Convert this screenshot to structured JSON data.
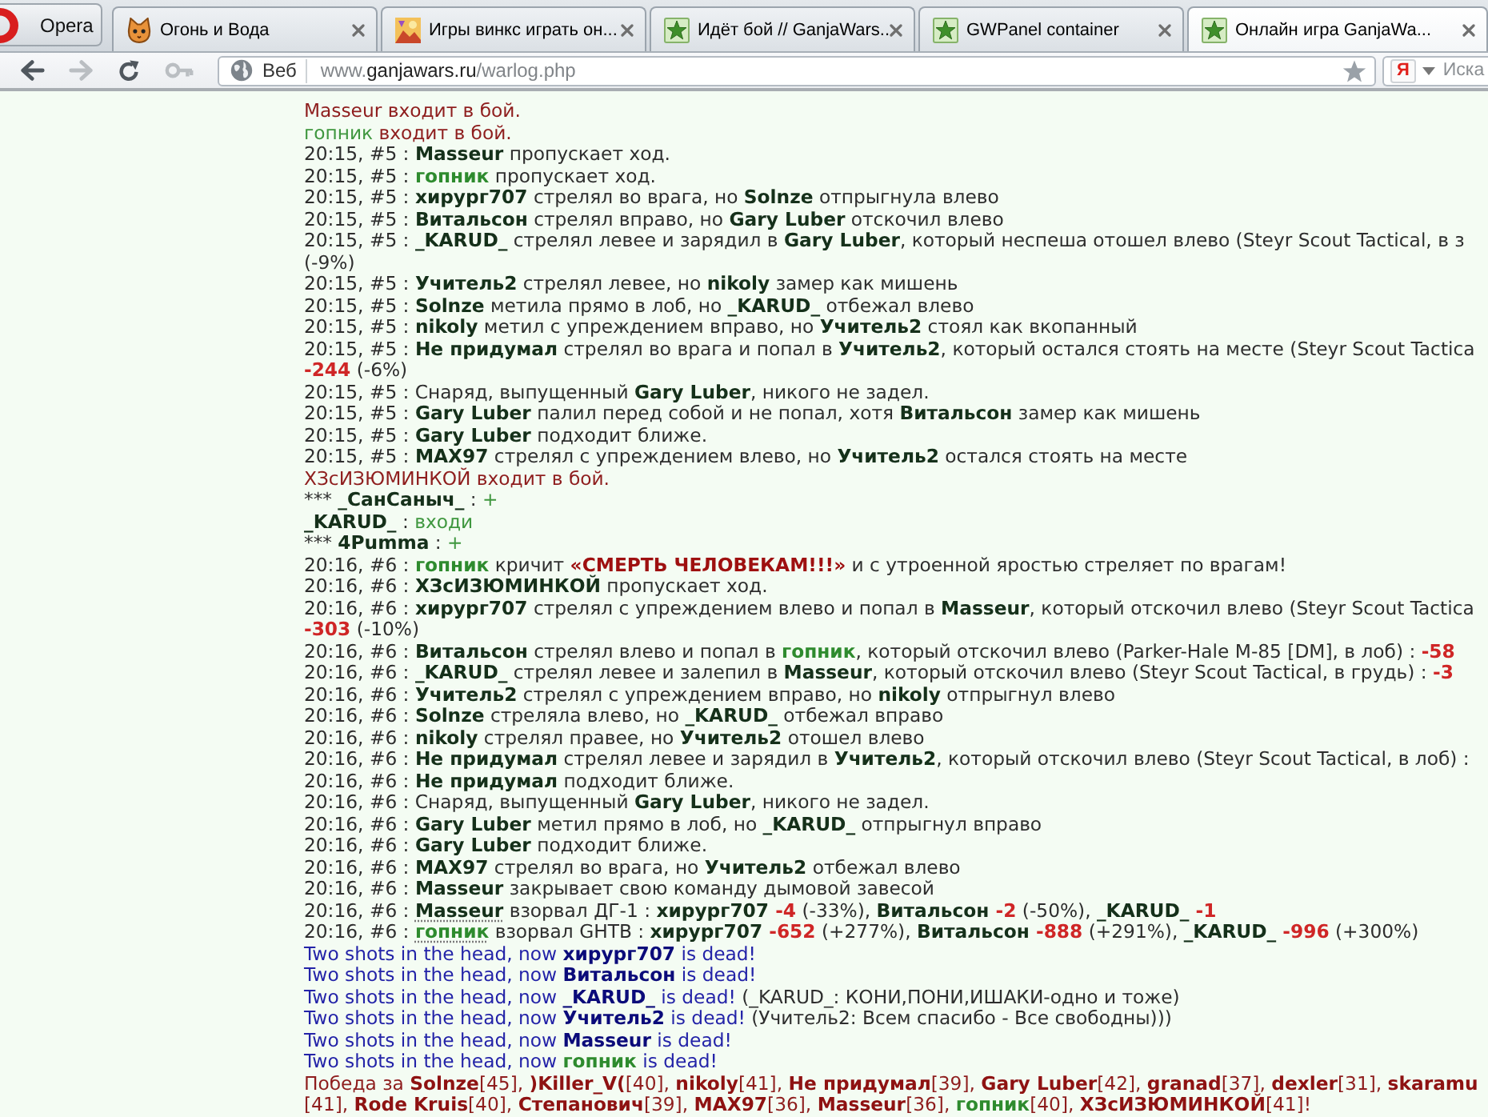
{
  "browser": {
    "menu_button": "Opera",
    "tabs": [
      {
        "kind": "cat",
        "title": "Огонь и Вода",
        "selected": false
      },
      {
        "kind": "picture",
        "title": "Игры винкс играть он...",
        "selected": false
      },
      {
        "kind": "star",
        "title": "Идёт бой // GanjaWars...",
        "selected": false
      },
      {
        "kind": "star",
        "title": "GWPanel container",
        "selected": false
      },
      {
        "kind": "star",
        "title": "Онлайн игра GanjaWa...",
        "selected": true
      }
    ]
  },
  "toolbar": {
    "buttons": [
      {
        "kind": "back",
        "disabled": false
      },
      {
        "kind": "forward",
        "disabled": true
      },
      {
        "kind": "reload",
        "disabled": false
      },
      {
        "kind": "key",
        "disabled": true
      }
    ],
    "address": {
      "site_button": "Веб",
      "url": {
        "prefix": "www.",
        "domain": "ganjawars.ru",
        "path": "/warlog.php"
      }
    },
    "search": {
      "engine": "Я",
      "placeholder": "Иска"
    }
  },
  "log": [
    {
      "parts": [
        {
          "kind": "event",
          "text": "Masseur входит в бой."
        }
      ]
    },
    {
      "parts": [
        {
          "kind": "ally-text",
          "text": "гопник"
        },
        {
          "kind": "event",
          "text": " входит в бой."
        }
      ]
    },
    {
      "parts": [
        {
          "kind": "text",
          "text": "20:15, #5 : "
        },
        {
          "kind": "name",
          "text": "Masseur"
        },
        {
          "kind": "text",
          "text": " пропускает ход."
        }
      ]
    },
    {
      "parts": [
        {
          "kind": "text",
          "text": "20:15, #5 : "
        },
        {
          "kind": "ally",
          "text": "гопник"
        },
        {
          "kind": "text",
          "text": " пропускает ход."
        }
      ]
    },
    {
      "parts": [
        {
          "kind": "text",
          "text": "20:15, #5 : "
        },
        {
          "kind": "name",
          "text": "хирург707"
        },
        {
          "kind": "text",
          "text": " стрелял во врага, но "
        },
        {
          "kind": "name",
          "text": "Solnze"
        },
        {
          "kind": "text",
          "text": " отпрыгнула влево"
        }
      ]
    },
    {
      "parts": [
        {
          "kind": "text",
          "text": "20:15, #5 : "
        },
        {
          "kind": "name",
          "text": "Витальсон"
        },
        {
          "kind": "text",
          "text": " стрелял вправо, но "
        },
        {
          "kind": "name",
          "text": "Gary Luber"
        },
        {
          "kind": "text",
          "text": " отскочил влево"
        }
      ]
    },
    {
      "parts": [
        {
          "kind": "text",
          "text": "20:15, #5 : "
        },
        {
          "kind": "name",
          "text": "_KARUD_"
        },
        {
          "kind": "text",
          "text": " стрелял левее и зарядил в "
        },
        {
          "kind": "name",
          "text": "Gary Luber"
        },
        {
          "kind": "text",
          "text": ", который неспеша отошел влево (Steyr Scout Tactical, в з"
        }
      ]
    },
    {
      "parts": [
        {
          "kind": "text",
          "text": "(-9%)"
        }
      ]
    },
    {
      "parts": [
        {
          "kind": "text",
          "text": "20:15, #5 : "
        },
        {
          "kind": "name",
          "text": "Учитель2"
        },
        {
          "kind": "text",
          "text": " стрелял левее, но "
        },
        {
          "kind": "name",
          "text": "nikoly"
        },
        {
          "kind": "text",
          "text": " замер как мишень"
        }
      ]
    },
    {
      "parts": [
        {
          "kind": "text",
          "text": "20:15, #5 : "
        },
        {
          "kind": "name",
          "text": "Solnze"
        },
        {
          "kind": "text",
          "text": " метила прямо в лоб, но "
        },
        {
          "kind": "name",
          "text": "_KARUD_"
        },
        {
          "kind": "text",
          "text": " отбежал влево"
        }
      ]
    },
    {
      "parts": [
        {
          "kind": "text",
          "text": "20:15, #5 : "
        },
        {
          "kind": "name",
          "text": "nikoly"
        },
        {
          "kind": "text",
          "text": " метил с упреждением вправо, но "
        },
        {
          "kind": "name",
          "text": "Учитель2"
        },
        {
          "kind": "text",
          "text": " стоял как вкопанный"
        }
      ]
    },
    {
      "parts": [
        {
          "kind": "text",
          "text": "20:15, #5 : "
        },
        {
          "kind": "name",
          "text": "Не придумал"
        },
        {
          "kind": "text",
          "text": " стрелял во врага и попал в "
        },
        {
          "kind": "name",
          "text": "Учитель2"
        },
        {
          "kind": "text",
          "text": ", который остался стоять на месте (Steyr Scout Tactica"
        }
      ]
    },
    {
      "parts": [
        {
          "kind": "damage",
          "text": "-244"
        },
        {
          "kind": "text",
          "text": " (-6%)"
        }
      ]
    },
    {
      "parts": [
        {
          "kind": "text",
          "text": "20:15, #5 : Снаряд, выпущенный "
        },
        {
          "kind": "name",
          "text": "Gary Luber"
        },
        {
          "kind": "text",
          "text": ", никого не задел."
        }
      ]
    },
    {
      "parts": [
        {
          "kind": "text",
          "text": "20:15, #5 : "
        },
        {
          "kind": "name",
          "text": "Gary Luber"
        },
        {
          "kind": "text",
          "text": " палил перед собой и не попал, хотя "
        },
        {
          "kind": "name",
          "text": "Витальсон"
        },
        {
          "kind": "text",
          "text": " замер как мишень"
        }
      ]
    },
    {
      "parts": [
        {
          "kind": "text",
          "text": "20:15, #5 : "
        },
        {
          "kind": "name",
          "text": "Gary Luber"
        },
        {
          "kind": "text",
          "text": " подходит ближе."
        }
      ]
    },
    {
      "parts": [
        {
          "kind": "text",
          "text": "20:15, #5 : "
        },
        {
          "kind": "name",
          "text": "MAX97"
        },
        {
          "kind": "text",
          "text": " стрелял с упреждением влево, но "
        },
        {
          "kind": "name",
          "text": "Учитель2"
        },
        {
          "kind": "text",
          "text": " остался стоять на месте"
        }
      ]
    },
    {
      "parts": [
        {
          "kind": "event",
          "text": "ХЗсИЗЮМИНКОЙ входит в бой."
        }
      ]
    },
    {
      "parts": [
        {
          "kind": "text",
          "text": "*** "
        },
        {
          "kind": "name",
          "text": "_СанСаныч_"
        },
        {
          "kind": "text",
          "text": " : "
        },
        {
          "kind": "ally-text",
          "text": "+"
        }
      ]
    },
    {
      "parts": [
        {
          "kind": "name",
          "text": "_KARUD_"
        },
        {
          "kind": "text",
          "text": " : "
        },
        {
          "kind": "ally-text",
          "text": "входи"
        }
      ]
    },
    {
      "parts": [
        {
          "kind": "text",
          "text": "*** "
        },
        {
          "kind": "name",
          "text": "4Pumma"
        },
        {
          "kind": "text",
          "text": " : "
        },
        {
          "kind": "ally-text",
          "text": "+"
        }
      ]
    },
    {
      "parts": [
        {
          "kind": "text",
          "text": "20:16, #6 : "
        },
        {
          "kind": "ally",
          "text": "гопник"
        },
        {
          "kind": "text",
          "text": " кричит "
        },
        {
          "kind": "shout",
          "text": "«СМЕРТЬ ЧЕЛОВЕКАМ!!!»"
        },
        {
          "kind": "text",
          "text": " и с утроенной яростью стреляет по врагам!"
        }
      ]
    },
    {
      "parts": [
        {
          "kind": "text",
          "text": "20:16, #6 : "
        },
        {
          "kind": "name",
          "text": "ХЗсИЗЮМИНКОЙ"
        },
        {
          "kind": "text",
          "text": " пропускает ход."
        }
      ]
    },
    {
      "parts": [
        {
          "kind": "text",
          "text": "20:16, #6 : "
        },
        {
          "kind": "name",
          "text": "хирург707"
        },
        {
          "kind": "text",
          "text": " стрелял с упреждением влево и попал в "
        },
        {
          "kind": "name",
          "text": "Masseur"
        },
        {
          "kind": "text",
          "text": ", который отскочил влево (Steyr Scout Tactica"
        }
      ]
    },
    {
      "parts": [
        {
          "kind": "damage",
          "text": "-303"
        },
        {
          "kind": "text",
          "text": " (-10%)"
        }
      ]
    },
    {
      "parts": [
        {
          "kind": "text",
          "text": "20:16, #6 : "
        },
        {
          "kind": "name",
          "text": "Витальсон"
        },
        {
          "kind": "text",
          "text": " стрелял влево и попал в "
        },
        {
          "kind": "ally",
          "text": "гопник"
        },
        {
          "kind": "text",
          "text": ", который отскочил влево (Parker-Hale M-85 [DM], в лоб) : "
        },
        {
          "kind": "damage",
          "text": "-58"
        }
      ]
    },
    {
      "parts": [
        {
          "kind": "text",
          "text": "20:16, #6 : "
        },
        {
          "kind": "name",
          "text": "_KARUD_"
        },
        {
          "kind": "text",
          "text": " стрелял левее и залепил в "
        },
        {
          "kind": "name",
          "text": "Masseur"
        },
        {
          "kind": "text",
          "text": ", который отскочил влево (Steyr Scout Tactical, в грудь) : "
        },
        {
          "kind": "damage",
          "text": "-3"
        }
      ]
    },
    {
      "parts": [
        {
          "kind": "text",
          "text": "20:16, #6 : "
        },
        {
          "kind": "name",
          "text": "Учитель2"
        },
        {
          "kind": "text",
          "text": " стрелял с упреждением вправо, но "
        },
        {
          "kind": "name",
          "text": "nikoly"
        },
        {
          "kind": "text",
          "text": " отпрыгнул влево"
        }
      ]
    },
    {
      "parts": [
        {
          "kind": "text",
          "text": "20:16, #6 : "
        },
        {
          "kind": "name",
          "text": "Solnze"
        },
        {
          "kind": "text",
          "text": " стреляла влево, но "
        },
        {
          "kind": "name",
          "text": "_KARUD_"
        },
        {
          "kind": "text",
          "text": " отбежал вправо"
        }
      ]
    },
    {
      "parts": [
        {
          "kind": "text",
          "text": "20:16, #6 : "
        },
        {
          "kind": "name",
          "text": "nikoly"
        },
        {
          "kind": "text",
          "text": " стрелял правее, но "
        },
        {
          "kind": "name",
          "text": "Учитель2"
        },
        {
          "kind": "text",
          "text": " отошел влево"
        }
      ]
    },
    {
      "parts": [
        {
          "kind": "text",
          "text": "20:16, #6 : "
        },
        {
          "kind": "name",
          "text": "Не придумал"
        },
        {
          "kind": "text",
          "text": " стрелял левее и зарядил в "
        },
        {
          "kind": "name",
          "text": "Учитель2"
        },
        {
          "kind": "text",
          "text": ", который отскочил влево (Steyr Scout Tactical, в лоб) :"
        }
      ]
    },
    {
      "parts": [
        {
          "kind": "text",
          "text": "20:16, #6 : "
        },
        {
          "kind": "name",
          "text": "Не придумал"
        },
        {
          "kind": "text",
          "text": " подходит ближе."
        }
      ]
    },
    {
      "parts": [
        {
          "kind": "text",
          "text": "20:16, #6 : Снаряд, выпущенный "
        },
        {
          "kind": "name",
          "text": "Gary Luber"
        },
        {
          "kind": "text",
          "text": ", никого не задел."
        }
      ]
    },
    {
      "parts": [
        {
          "kind": "text",
          "text": "20:16, #6 : "
        },
        {
          "kind": "name",
          "text": "Gary Luber"
        },
        {
          "kind": "text",
          "text": " метил прямо в лоб, но "
        },
        {
          "kind": "name",
          "text": "_KARUD_"
        },
        {
          "kind": "text",
          "text": " отпрыгнул вправо"
        }
      ]
    },
    {
      "parts": [
        {
          "kind": "text",
          "text": "20:16, #6 : "
        },
        {
          "kind": "name",
          "text": "Gary Luber"
        },
        {
          "kind": "text",
          "text": " подходит ближе."
        }
      ]
    },
    {
      "parts": [
        {
          "kind": "text",
          "text": "20:16, #6 : "
        },
        {
          "kind": "name",
          "text": "MAX97"
        },
        {
          "kind": "text",
          "text": " стрелял во врага, но "
        },
        {
          "kind": "name",
          "text": "Учитель2"
        },
        {
          "kind": "text",
          "text": " отбежал влево"
        }
      ]
    },
    {
      "parts": [
        {
          "kind": "text",
          "text": "20:16, #6 : "
        },
        {
          "kind": "name",
          "text": "Masseur"
        },
        {
          "kind": "text",
          "text": " закрывает свою команду дымовой завесой"
        }
      ]
    },
    {
      "parts": [
        {
          "kind": "text",
          "text": "20:16, #6 : "
        },
        {
          "kind": "name",
          "text": "Masseur",
          "underlined": true
        },
        {
          "kind": "text",
          "text": " взорвал ДГ-1 : "
        },
        {
          "kind": "name",
          "text": "хирург707"
        },
        {
          "kind": "damage",
          "text": " -4"
        },
        {
          "kind": "text",
          "text": " (-33%), "
        },
        {
          "kind": "name",
          "text": "Витальсон"
        },
        {
          "kind": "damage",
          "text": " -2"
        },
        {
          "kind": "text",
          "text": " (-50%), "
        },
        {
          "kind": "name",
          "text": "_KARUD_"
        },
        {
          "kind": "damage",
          "text": " -1"
        }
      ]
    },
    {
      "parts": [
        {
          "kind": "text",
          "text": "20:16, #6 : "
        },
        {
          "kind": "ally",
          "text": "гопник",
          "underlined": true
        },
        {
          "kind": "text",
          "text": " взорвал GHTB : "
        },
        {
          "kind": "name",
          "text": "хирург707"
        },
        {
          "kind": "damage",
          "text": " -652"
        },
        {
          "kind": "text",
          "text": " (+277%), "
        },
        {
          "kind": "name",
          "text": "Витальсон"
        },
        {
          "kind": "damage",
          "text": " -888"
        },
        {
          "kind": "text",
          "text": " (+291%), "
        },
        {
          "kind": "name",
          "text": "_KARUD_"
        },
        {
          "kind": "damage",
          "text": " -996"
        },
        {
          "kind": "text",
          "text": " (+300%)"
        }
      ]
    },
    {
      "parts": [
        {
          "kind": "death",
          "text": "Two shots in the head, now "
        },
        {
          "kind": "victim",
          "text": "хирург707"
        },
        {
          "kind": "death",
          "text": " is dead!"
        }
      ]
    },
    {
      "parts": [
        {
          "kind": "death",
          "text": "Two shots in the head, now "
        },
        {
          "kind": "victim",
          "text": "Витальсон"
        },
        {
          "kind": "death",
          "text": " is dead!"
        }
      ]
    },
    {
      "parts": [
        {
          "kind": "death",
          "text": "Two shots in the head, now "
        },
        {
          "kind": "victim",
          "text": "_KARUD_"
        },
        {
          "kind": "death",
          "text": " is dead!"
        },
        {
          "kind": "text",
          "text": " (_KARUD_: КОНИ,ПОНИ,ИШАКИ-одно и тоже)"
        }
      ]
    },
    {
      "parts": [
        {
          "kind": "death",
          "text": "Two shots in the head, now "
        },
        {
          "kind": "victim",
          "text": "Учитель2"
        },
        {
          "kind": "death",
          "text": " is dead!"
        },
        {
          "kind": "text",
          "text": " (Учитель2: Всем спасибо - Все свободны)))"
        }
      ]
    },
    {
      "parts": [
        {
          "kind": "death",
          "text": "Two shots in the head, now "
        },
        {
          "kind": "victim",
          "text": "Masseur"
        },
        {
          "kind": "death",
          "text": " is dead!"
        }
      ]
    },
    {
      "parts": [
        {
          "kind": "death",
          "text": "Two shots in the head, now "
        },
        {
          "kind": "ally",
          "text": "гопник"
        },
        {
          "kind": "death",
          "text": " is dead!"
        }
      ]
    },
    {
      "parts": [
        {
          "kind": "event",
          "text": "Победа за "
        },
        {
          "kind": "winner",
          "text": "Solnze"
        },
        {
          "kind": "event",
          "text": "[45], "
        },
        {
          "kind": "winner",
          "text": ")Killer_V("
        },
        {
          "kind": "event",
          "text": "[40], "
        },
        {
          "kind": "winner",
          "text": "nikoly"
        },
        {
          "kind": "event",
          "text": "[41], "
        },
        {
          "kind": "winner",
          "text": "Не придумал"
        },
        {
          "kind": "event",
          "text": "[39], "
        },
        {
          "kind": "winner",
          "text": "Gary Luber"
        },
        {
          "kind": "event",
          "text": "[42], "
        },
        {
          "kind": "winner",
          "text": "granad"
        },
        {
          "kind": "event",
          "text": "[37], "
        },
        {
          "kind": "winner",
          "text": "dexler"
        },
        {
          "kind": "event",
          "text": "[31], "
        },
        {
          "kind": "winner",
          "text": "skaramu"
        }
      ]
    },
    {
      "parts": [
        {
          "kind": "event",
          "text": "[41], "
        },
        {
          "kind": "winner",
          "text": "Rode Kruis"
        },
        {
          "kind": "event",
          "text": "[40], "
        },
        {
          "kind": "winner",
          "text": "Степанович"
        },
        {
          "kind": "event",
          "text": "[39], "
        },
        {
          "kind": "winner",
          "text": "MAX97"
        },
        {
          "kind": "event",
          "text": "[36], "
        },
        {
          "kind": "winner",
          "text": "Masseur"
        },
        {
          "kind": "event",
          "text": "[36], "
        },
        {
          "kind": "ally",
          "text": "гопник"
        },
        {
          "kind": "event",
          "text": "[40], "
        },
        {
          "kind": "winner",
          "text": "ХЗсИЗЮМИНКОЙ"
        },
        {
          "kind": "event",
          "text": "[41]!"
        }
      ]
    }
  ]
}
